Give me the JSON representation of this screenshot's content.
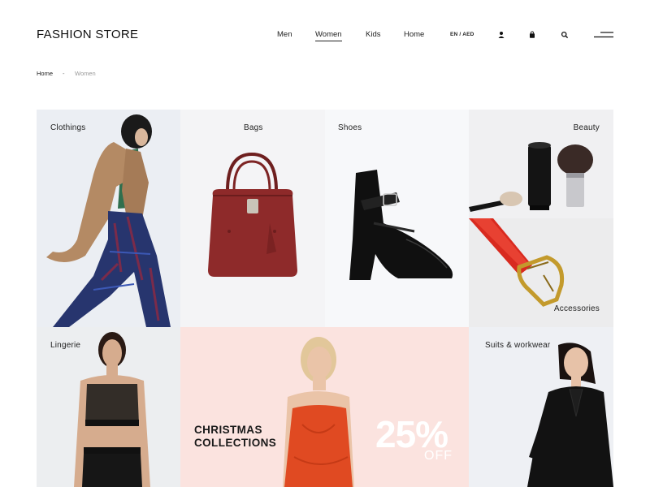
{
  "header": {
    "logo": "FASHION STORE",
    "nav": [
      {
        "label": "Men"
      },
      {
        "label": "Women",
        "active": true
      },
      {
        "label": "Kids"
      },
      {
        "label": "Home"
      }
    ],
    "language": "EN / AED",
    "icons": [
      "user-icon",
      "shopping-bag-icon",
      "search-icon",
      "menu-icon"
    ]
  },
  "breadcrumb": {
    "home": "Home",
    "separator": "-",
    "current": "Women"
  },
  "categories": {
    "clothings": "Clothings",
    "bags": "Bags",
    "shoes": "Shoes",
    "beauty": "Beauty",
    "accessories": "Accessories",
    "lingerie": "Lingerie",
    "suits": "Suits & workwear"
  },
  "promo": {
    "title_line1": "CHRISTMAS",
    "title_line2": "COLLECTIONS",
    "discount": "25%",
    "discount_suffix": "OFF"
  },
  "colors": {
    "accent": "#111111",
    "promo_background": "#fbe3df",
    "bag": "#8e2a2a",
    "dress": "#e04a22"
  }
}
